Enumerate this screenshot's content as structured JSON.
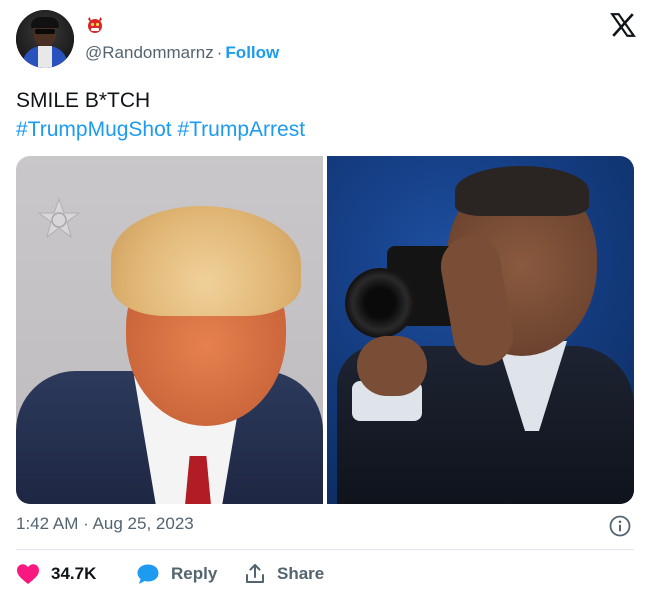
{
  "author": {
    "handle": "@Randommarnz",
    "follow_label": "Follow",
    "separator": "·"
  },
  "tweet": {
    "text": "SMILE B*TCH",
    "hashtags": "#TrumpMugShot #TrumpArrest"
  },
  "meta": {
    "time": "1:42 AM",
    "separator": "·",
    "date": "Aug 25, 2023"
  },
  "actions": {
    "likes": "34.7K",
    "reply_label": "Reply",
    "share_label": "Share"
  },
  "icons": {
    "brand": "x-logo-icon",
    "like": "heart-icon",
    "reply": "speech-bubble-icon",
    "share": "share-icon",
    "info": "info-icon"
  },
  "colors": {
    "link": "#1d9bf0",
    "like": "#f91880",
    "muted": "#536471",
    "text": "#0f1419"
  }
}
